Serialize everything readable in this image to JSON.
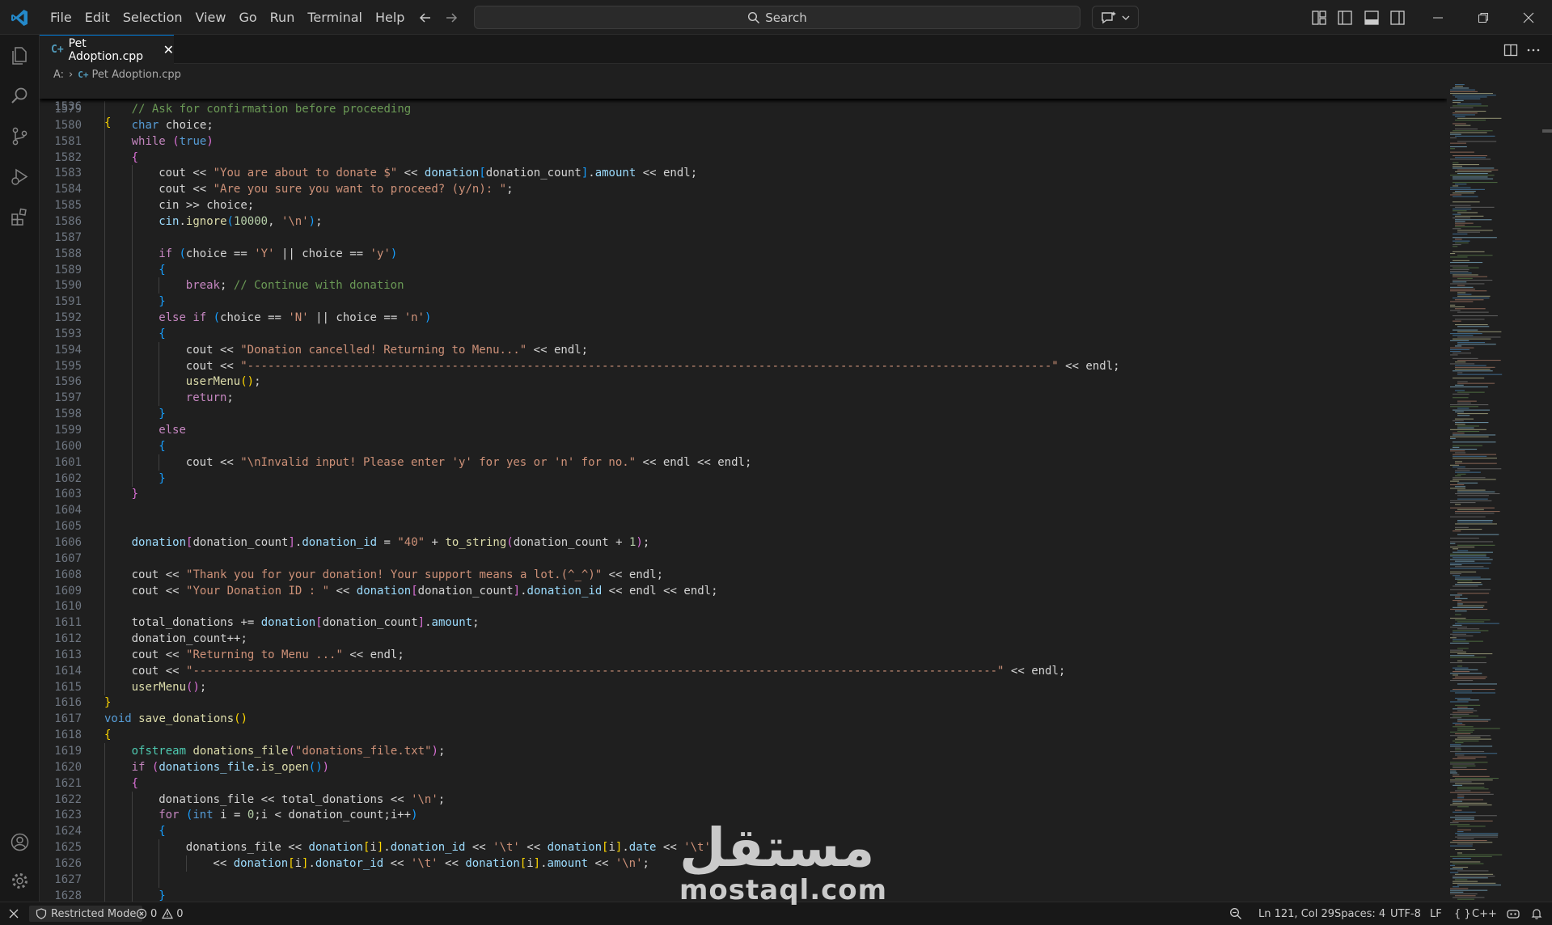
{
  "menu": [
    "File",
    "Edit",
    "Selection",
    "View",
    "Go",
    "Run",
    "Terminal",
    "Help"
  ],
  "search": {
    "label": "Search"
  },
  "tab": {
    "title": "Pet Adoption.cpp",
    "icon": "cpp-file-icon",
    "close": "✕"
  },
  "breadcrumb": {
    "drive": "A:",
    "file": "Pet Adoption.cpp"
  },
  "sticky_line": {
    "num": "1536",
    "text": "{"
  },
  "code_lines": [
    {
      "n": "1579",
      "indent": 1,
      "tokens": [
        [
          "cmt",
          "// Ask for confirmation before proceeding"
        ]
      ]
    },
    {
      "n": "1580",
      "indent": 1,
      "tokens": [
        [
          "kw",
          "char"
        ],
        [
          "txt",
          " choice;"
        ]
      ]
    },
    {
      "n": "1581",
      "indent": 1,
      "tokens": [
        [
          "ctl",
          "while"
        ],
        [
          "txt",
          " "
        ],
        [
          "br2",
          "("
        ],
        [
          "kw",
          "true"
        ],
        [
          "br2",
          ")"
        ]
      ]
    },
    {
      "n": "1582",
      "indent": 1,
      "tokens": [
        [
          "br2",
          "{"
        ]
      ]
    },
    {
      "n": "1583",
      "indent": 2,
      "tokens": [
        [
          "txt",
          "cout << "
        ],
        [
          "str",
          "\"You are about to donate $\""
        ],
        [
          "txt",
          " << "
        ],
        [
          "var",
          "donation"
        ],
        [
          "br3",
          "["
        ],
        [
          "txt",
          "donation_count"
        ],
        [
          "br3",
          "]"
        ],
        [
          "txt",
          "."
        ],
        [
          "var",
          "amount"
        ],
        [
          "txt",
          " << endl;"
        ]
      ]
    },
    {
      "n": "1584",
      "indent": 2,
      "tokens": [
        [
          "txt",
          "cout << "
        ],
        [
          "str",
          "\"Are you sure you want to proceed? (y/n): \""
        ],
        [
          "txt",
          ";"
        ]
      ]
    },
    {
      "n": "1585",
      "indent": 2,
      "tokens": [
        [
          "txt",
          "cin >> choice;"
        ]
      ]
    },
    {
      "n": "1586",
      "indent": 2,
      "tokens": [
        [
          "var",
          "cin"
        ],
        [
          "txt",
          "."
        ],
        [
          "fn",
          "ignore"
        ],
        [
          "br3",
          "("
        ],
        [
          "num",
          "10000"
        ],
        [
          "txt",
          ", "
        ],
        [
          "str",
          "'\\n'"
        ],
        [
          "br3",
          ")"
        ],
        [
          "txt",
          ";"
        ]
      ]
    },
    {
      "n": "1587",
      "indent": 2,
      "tokens": []
    },
    {
      "n": "1588",
      "indent": 2,
      "tokens": [
        [
          "ctl",
          "if"
        ],
        [
          "txt",
          " "
        ],
        [
          "br3",
          "("
        ],
        [
          "txt",
          "choice == "
        ],
        [
          "str",
          "'Y'"
        ],
        [
          "txt",
          " || choice == "
        ],
        [
          "str",
          "'y'"
        ],
        [
          "br3",
          ")"
        ]
      ]
    },
    {
      "n": "1589",
      "indent": 2,
      "tokens": [
        [
          "br3",
          "{"
        ]
      ]
    },
    {
      "n": "1590",
      "indent": 3,
      "tokens": [
        [
          "ctl",
          "break"
        ],
        [
          "txt",
          "; "
        ],
        [
          "cmt",
          "// Continue with donation"
        ]
      ]
    },
    {
      "n": "1591",
      "indent": 2,
      "tokens": [
        [
          "br3",
          "}"
        ]
      ]
    },
    {
      "n": "1592",
      "indent": 2,
      "tokens": [
        [
          "ctl",
          "else if"
        ],
        [
          "txt",
          " "
        ],
        [
          "br3",
          "("
        ],
        [
          "txt",
          "choice == "
        ],
        [
          "str",
          "'N'"
        ],
        [
          "txt",
          " || choice == "
        ],
        [
          "str",
          "'n'"
        ],
        [
          "br3",
          ")"
        ]
      ]
    },
    {
      "n": "1593",
      "indent": 2,
      "tokens": [
        [
          "br3",
          "{"
        ]
      ]
    },
    {
      "n": "1594",
      "indent": 3,
      "tokens": [
        [
          "txt",
          "cout << "
        ],
        [
          "str",
          "\"Donation cancelled! Returning to Menu...\""
        ],
        [
          "txt",
          " << endl;"
        ]
      ]
    },
    {
      "n": "1595",
      "indent": 3,
      "tokens": [
        [
          "txt",
          "cout << "
        ],
        [
          "str",
          "\"----------------------------------------------------------------------------------------------------------------------\""
        ],
        [
          "txt",
          " << endl;"
        ]
      ]
    },
    {
      "n": "1596",
      "indent": 3,
      "tokens": [
        [
          "fn",
          "userMenu"
        ],
        [
          "br1",
          "()"
        ],
        [
          "txt",
          ";"
        ]
      ]
    },
    {
      "n": "1597",
      "indent": 3,
      "tokens": [
        [
          "ctl",
          "return"
        ],
        [
          "txt",
          ";"
        ]
      ]
    },
    {
      "n": "1598",
      "indent": 2,
      "tokens": [
        [
          "br3",
          "}"
        ]
      ]
    },
    {
      "n": "1599",
      "indent": 2,
      "tokens": [
        [
          "ctl",
          "else"
        ]
      ]
    },
    {
      "n": "1600",
      "indent": 2,
      "tokens": [
        [
          "br3",
          "{"
        ]
      ]
    },
    {
      "n": "1601",
      "indent": 3,
      "tokens": [
        [
          "txt",
          "cout << "
        ],
        [
          "str",
          "\"\\nInvalid input! Please enter 'y' for yes or 'n' for no.\""
        ],
        [
          "txt",
          " << endl << endl;"
        ]
      ]
    },
    {
      "n": "1602",
      "indent": 2,
      "tokens": [
        [
          "br3",
          "}"
        ]
      ]
    },
    {
      "n": "1603",
      "indent": 1,
      "tokens": [
        [
          "br2",
          "}"
        ]
      ]
    },
    {
      "n": "1604",
      "indent": 1,
      "tokens": []
    },
    {
      "n": "1605",
      "indent": 1,
      "tokens": []
    },
    {
      "n": "1606",
      "indent": 1,
      "tokens": [
        [
          "var",
          "donation"
        ],
        [
          "br2",
          "["
        ],
        [
          "txt",
          "donation_count"
        ],
        [
          "br2",
          "]"
        ],
        [
          "txt",
          "."
        ],
        [
          "var",
          "donation_id"
        ],
        [
          "txt",
          " = "
        ],
        [
          "str",
          "\"40\""
        ],
        [
          "txt",
          " + "
        ],
        [
          "fn",
          "to_string"
        ],
        [
          "br2",
          "("
        ],
        [
          "txt",
          "donation_count + "
        ],
        [
          "num",
          "1"
        ],
        [
          "br2",
          ")"
        ],
        [
          "txt",
          ";"
        ]
      ]
    },
    {
      "n": "1607",
      "indent": 1,
      "tokens": []
    },
    {
      "n": "1608",
      "indent": 1,
      "tokens": [
        [
          "txt",
          "cout << "
        ],
        [
          "str",
          "\"Thank you for your donation! Your support means a lot.(^_^)\""
        ],
        [
          "txt",
          " << endl;"
        ]
      ]
    },
    {
      "n": "1609",
      "indent": 1,
      "tokens": [
        [
          "txt",
          "cout << "
        ],
        [
          "str",
          "\"Your Donation ID : \""
        ],
        [
          "txt",
          " << "
        ],
        [
          "var",
          "donation"
        ],
        [
          "br2",
          "["
        ],
        [
          "txt",
          "donation_count"
        ],
        [
          "br2",
          "]"
        ],
        [
          "txt",
          "."
        ],
        [
          "var",
          "donation_id"
        ],
        [
          "txt",
          " << endl << endl;"
        ]
      ]
    },
    {
      "n": "1610",
      "indent": 1,
      "tokens": []
    },
    {
      "n": "1611",
      "indent": 1,
      "tokens": [
        [
          "txt",
          "total_donations += "
        ],
        [
          "var",
          "donation"
        ],
        [
          "br2",
          "["
        ],
        [
          "txt",
          "donation_count"
        ],
        [
          "br2",
          "]"
        ],
        [
          "txt",
          "."
        ],
        [
          "var",
          "amount"
        ],
        [
          "txt",
          ";"
        ]
      ]
    },
    {
      "n": "1612",
      "indent": 1,
      "tokens": [
        [
          "txt",
          "donation_count++;"
        ]
      ]
    },
    {
      "n": "1613",
      "indent": 1,
      "tokens": [
        [
          "txt",
          "cout << "
        ],
        [
          "str",
          "\"Returning to Menu ...\""
        ],
        [
          "txt",
          " << endl;"
        ]
      ]
    },
    {
      "n": "1614",
      "indent": 1,
      "tokens": [
        [
          "txt",
          "cout << "
        ],
        [
          "str",
          "\"----------------------------------------------------------------------------------------------------------------------\""
        ],
        [
          "txt",
          " << endl;"
        ]
      ]
    },
    {
      "n": "1615",
      "indent": 1,
      "tokens": [
        [
          "fn",
          "userMenu"
        ],
        [
          "br2",
          "()"
        ],
        [
          "txt",
          ";"
        ]
      ]
    },
    {
      "n": "1616",
      "indent": 0,
      "tokens": [
        [
          "br1",
          "}"
        ]
      ]
    },
    {
      "n": "1617",
      "indent": 0,
      "tokens": [
        [
          "kw",
          "void"
        ],
        [
          "txt",
          " "
        ],
        [
          "fn",
          "save_donations"
        ],
        [
          "br1",
          "()"
        ]
      ]
    },
    {
      "n": "1618",
      "indent": 0,
      "tokens": [
        [
          "br1",
          "{"
        ]
      ]
    },
    {
      "n": "1619",
      "indent": 1,
      "tokens": [
        [
          "typ",
          "ofstream"
        ],
        [
          "txt",
          " "
        ],
        [
          "fn",
          "donations_file"
        ],
        [
          "br2",
          "("
        ],
        [
          "str",
          "\"donations_file.txt\""
        ],
        [
          "br2",
          ")"
        ],
        [
          "txt",
          ";"
        ]
      ]
    },
    {
      "n": "1620",
      "indent": 1,
      "tokens": [
        [
          "ctl",
          "if"
        ],
        [
          "txt",
          " "
        ],
        [
          "br2",
          "("
        ],
        [
          "var",
          "donations_file"
        ],
        [
          "txt",
          "."
        ],
        [
          "fn",
          "is_open"
        ],
        [
          "br3",
          "()"
        ],
        [
          "br2",
          ")"
        ]
      ]
    },
    {
      "n": "1621",
      "indent": 1,
      "tokens": [
        [
          "br2",
          "{"
        ]
      ]
    },
    {
      "n": "1622",
      "indent": 2,
      "tokens": [
        [
          "txt",
          "donations_file << total_donations << "
        ],
        [
          "str",
          "'\\n'"
        ],
        [
          "txt",
          ";"
        ]
      ]
    },
    {
      "n": "1623",
      "indent": 2,
      "tokens": [
        [
          "ctl",
          "for"
        ],
        [
          "txt",
          " "
        ],
        [
          "br3",
          "("
        ],
        [
          "kw",
          "int"
        ],
        [
          "txt",
          " i = "
        ],
        [
          "num",
          "0"
        ],
        [
          "txt",
          ";i < donation_count;i++"
        ],
        [
          "br3",
          ")"
        ]
      ]
    },
    {
      "n": "1624",
      "indent": 2,
      "tokens": [
        [
          "br3",
          "{"
        ]
      ]
    },
    {
      "n": "1625",
      "indent": 3,
      "tokens": [
        [
          "txt",
          "donations_file << "
        ],
        [
          "var",
          "donation"
        ],
        [
          "br1",
          "["
        ],
        [
          "txt",
          "i"
        ],
        [
          "br1",
          "]"
        ],
        [
          "txt",
          "."
        ],
        [
          "var",
          "donation_id"
        ],
        [
          "txt",
          " << "
        ],
        [
          "str",
          "'\\t'"
        ],
        [
          "txt",
          " << "
        ],
        [
          "var",
          "donation"
        ],
        [
          "br1",
          "["
        ],
        [
          "txt",
          "i"
        ],
        [
          "br1",
          "]"
        ],
        [
          "txt",
          "."
        ],
        [
          "var",
          "date"
        ],
        [
          "txt",
          " << "
        ],
        [
          "str",
          "'\\t'"
        ]
      ]
    },
    {
      "n": "1626",
      "indent": 4,
      "tokens": [
        [
          "txt",
          "<< "
        ],
        [
          "var",
          "donation"
        ],
        [
          "br1",
          "["
        ],
        [
          "txt",
          "i"
        ],
        [
          "br1",
          "]"
        ],
        [
          "txt",
          "."
        ],
        [
          "var",
          "donator_id"
        ],
        [
          "txt",
          " << "
        ],
        [
          "str",
          "'\\t'"
        ],
        [
          "txt",
          " << "
        ],
        [
          "var",
          "donation"
        ],
        [
          "br1",
          "["
        ],
        [
          "txt",
          "i"
        ],
        [
          "br1",
          "]"
        ],
        [
          "txt",
          "."
        ],
        [
          "var",
          "amount"
        ],
        [
          "txt",
          " << "
        ],
        [
          "str",
          "'\\n'"
        ],
        [
          "txt",
          ";"
        ]
      ]
    },
    {
      "n": "1627",
      "indent": 3,
      "tokens": []
    },
    {
      "n": "1628",
      "indent": 2,
      "tokens": [
        [
          "br3",
          "}"
        ]
      ]
    }
  ],
  "status": {
    "restricted": "Restricted Mode",
    "errors": "0",
    "warnings": "0",
    "position": "Ln 121, Col 29",
    "spaces": "Spaces: 4",
    "encoding": "UTF-8",
    "eol": "LF",
    "braces": "{ }",
    "language": "C++"
  },
  "watermark": {
    "arabic": "مستقل",
    "latin": "mostaql.com"
  },
  "colors": {
    "accent": "#0078d4",
    "keyword": "#569cd6",
    "control": "#c586c0",
    "string": "#ce9178",
    "comment": "#6a9955",
    "function": "#dcdcaa",
    "variable": "#9cdcfe",
    "type": "#4ec9b0"
  }
}
